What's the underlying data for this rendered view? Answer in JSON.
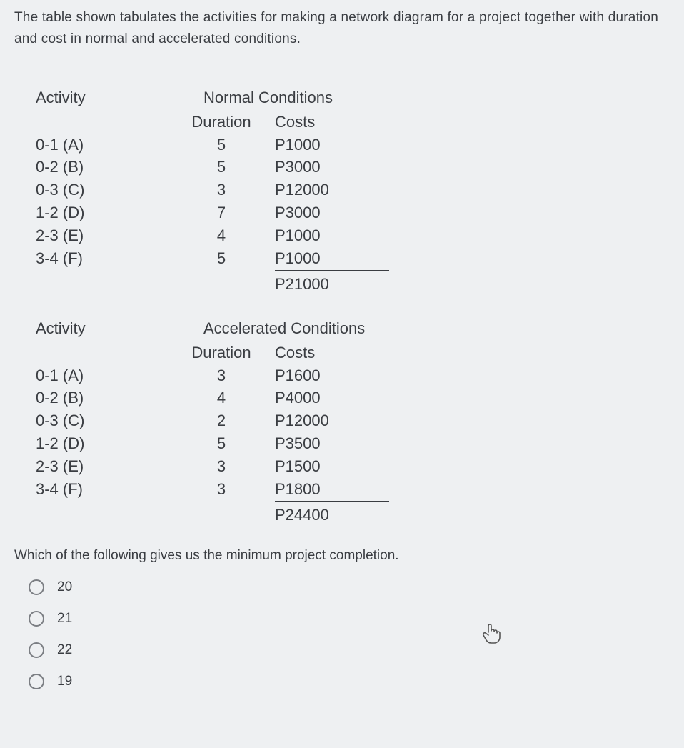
{
  "intro": "The table shown tabulates the activities for making a network diagram for a project together with duration and cost in normal and accelerated conditions.",
  "headers": {
    "activity": "Activity",
    "duration": "Duration",
    "costs": "Costs"
  },
  "normal": {
    "title": "Normal Conditions",
    "rows": [
      {
        "act": "0-1 (A)",
        "dur": "5",
        "cost": "P1000"
      },
      {
        "act": "0-2 (B)",
        "dur": "5",
        "cost": "P3000"
      },
      {
        "act": "0-3 (C)",
        "dur": "3",
        "cost": "P12000"
      },
      {
        "act": "1-2 (D)",
        "dur": "7",
        "cost": "P3000"
      },
      {
        "act": "2-3 (E)",
        "dur": "4",
        "cost": "P1000"
      },
      {
        "act": "3-4 (F)",
        "dur": "5",
        "cost": "P1000"
      }
    ],
    "total": "P21000"
  },
  "accel": {
    "title": "Accelerated Conditions",
    "rows": [
      {
        "act": "0-1 (A)",
        "dur": "3",
        "cost": "P1600"
      },
      {
        "act": "0-2 (B)",
        "dur": "4",
        "cost": "P4000"
      },
      {
        "act": "0-3 (C)",
        "dur": "2",
        "cost": "P12000"
      },
      {
        "act": "1-2 (D)",
        "dur": "5",
        "cost": "P3500"
      },
      {
        "act": "2-3 (E)",
        "dur": "3",
        "cost": "P1500"
      },
      {
        "act": "3-4 (F)",
        "dur": "3",
        "cost": "P1800"
      }
    ],
    "total": "P24400"
  },
  "question": "Which of the following gives us the minimum project completion.",
  "options": [
    "20",
    "21",
    "22",
    "19"
  ]
}
